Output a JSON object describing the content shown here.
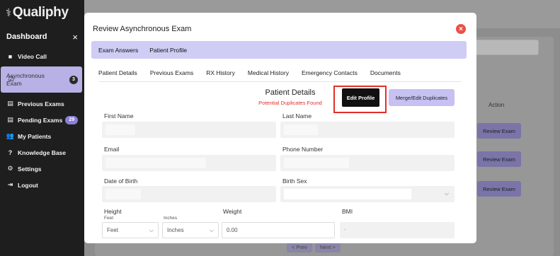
{
  "app": {
    "logo_text": "Qualiphy",
    "dashboard_label": "Dashboard",
    "close_symbol": "×"
  },
  "sidebar": {
    "items": [
      {
        "label": "Video Call",
        "icon": "video-icon"
      },
      {
        "label": "Asynchronous Exam",
        "icon": "checkbox-icon",
        "badge": "3",
        "active": true
      },
      {
        "label": "Previous Exams",
        "icon": "clipboard-icon"
      },
      {
        "label": "Pending Exams",
        "icon": "clipboard-icon",
        "badge": "29"
      },
      {
        "label": "My Patients",
        "icon": "users-icon"
      },
      {
        "label": "Knowledge Base",
        "icon": "question-icon"
      },
      {
        "label": "Settings",
        "icon": "gear-icon"
      },
      {
        "label": "Logout",
        "icon": "logout-icon"
      }
    ]
  },
  "background": {
    "action_header": "Action",
    "review_buttons": [
      "Review Exam",
      "Review Exam",
      "Review Exam"
    ],
    "pager_prev": "< Prev",
    "pager_next": "Next >"
  },
  "modal": {
    "title": "Review Asynchronous Exam",
    "close_symbol": "×",
    "top_tabs": [
      "Exam Answers",
      "Patient Profile"
    ],
    "sub_tabs": [
      "Patient Details",
      "Previous Exams",
      "RX History",
      "Medical History",
      "Emergency Contacts",
      "Documents"
    ],
    "section_title": "Patient Details",
    "duplicates_warning": "Potential Duplicates Found",
    "edit_profile_label": "Edit Profile",
    "merge_label": "Merge/Edit Duplicates",
    "fields": {
      "first_name_label": "First Name",
      "first_name_value": "",
      "last_name_label": "Last Name",
      "last_name_value": "",
      "email_label": "Email",
      "email_value": "",
      "phone_label": "Phone Number",
      "phone_value": "",
      "dob_label": "Date of Birth",
      "dob_value": "",
      "birth_sex_label": "Birth Sex",
      "birth_sex_value": "",
      "height_label": "Height",
      "feet_label": "Feet",
      "feet_value": "Feet",
      "inches_label": "Inches",
      "inches_value": "Inches",
      "weight_label": "Weight",
      "weight_value": "0.00",
      "bmi_label": "BMI",
      "bmi_value": "-"
    }
  },
  "colors": {
    "accent": "#c6c1f2",
    "sidebar_bg": "#1e1e1e",
    "active_item": "#b7b1e6",
    "close": "#e8524a",
    "warning": "#e0302a"
  }
}
